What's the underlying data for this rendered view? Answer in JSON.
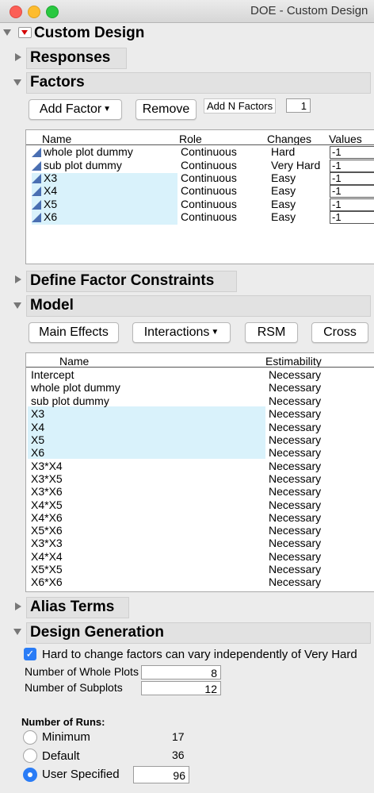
{
  "window": {
    "title": "DOE - Custom Design"
  },
  "outline": {
    "title": "Custom Design",
    "sections": {
      "responses": "Responses",
      "factors": "Factors",
      "constraints": "Define Factor Constraints",
      "model": "Model",
      "alias": "Alias Terms",
      "generation": "Design Generation"
    }
  },
  "factors": {
    "add_factor_label": "Add Factor",
    "remove_label": "Remove",
    "add_n_label": "Add N Factors",
    "add_n_value": "1",
    "columns": [
      "Name",
      "Role",
      "Changes",
      "Values"
    ],
    "rows": [
      {
        "name": "whole plot dummy",
        "role": "Continuous",
        "changes": "Hard",
        "value": "-1",
        "highlight": false
      },
      {
        "name": "sub plot dummy",
        "role": "Continuous",
        "changes": "Very Hard",
        "value": "-1",
        "highlight": false
      },
      {
        "name": "X3",
        "role": "Continuous",
        "changes": "Easy",
        "value": "-1",
        "highlight": true
      },
      {
        "name": "X4",
        "role": "Continuous",
        "changes": "Easy",
        "value": "-1",
        "highlight": true
      },
      {
        "name": "X5",
        "role": "Continuous",
        "changes": "Easy",
        "value": "-1",
        "highlight": true
      },
      {
        "name": "X6",
        "role": "Continuous",
        "changes": "Easy",
        "value": "-1",
        "highlight": true
      }
    ]
  },
  "model": {
    "buttons": {
      "main_effects": "Main Effects",
      "interactions": "Interactions",
      "rsm": "RSM",
      "cross": "Cross"
    },
    "columns": [
      "Name",
      "Estimability"
    ],
    "terms": [
      {
        "name": "Intercept",
        "est": "Necessary",
        "highlight": false
      },
      {
        "name": "whole plot dummy",
        "est": "Necessary",
        "highlight": false
      },
      {
        "name": "sub plot dummy",
        "est": "Necessary",
        "highlight": false
      },
      {
        "name": "X3",
        "est": "Necessary",
        "highlight": true
      },
      {
        "name": "X4",
        "est": "Necessary",
        "highlight": true
      },
      {
        "name": "X5",
        "est": "Necessary",
        "highlight": true
      },
      {
        "name": "X6",
        "est": "Necessary",
        "highlight": true
      },
      {
        "name": "X3*X4",
        "est": "Necessary",
        "highlight": false
      },
      {
        "name": "X3*X5",
        "est": "Necessary",
        "highlight": false
      },
      {
        "name": "X3*X6",
        "est": "Necessary",
        "highlight": false
      },
      {
        "name": "X4*X5",
        "est": "Necessary",
        "highlight": false
      },
      {
        "name": "X4*X6",
        "est": "Necessary",
        "highlight": false
      },
      {
        "name": "X5*X6",
        "est": "Necessary",
        "highlight": false
      },
      {
        "name": "X3*X3",
        "est": "Necessary",
        "highlight": false
      },
      {
        "name": "X4*X4",
        "est": "Necessary",
        "highlight": false
      },
      {
        "name": "X5*X5",
        "est": "Necessary",
        "highlight": false
      },
      {
        "name": "X6*X6",
        "est": "Necessary",
        "highlight": false
      }
    ]
  },
  "generation": {
    "hard_to_change_label": "Hard to change factors can vary independently of Very Hard",
    "hard_to_change_checked": true,
    "whole_plots_label": "Number of Whole Plots",
    "whole_plots_value": "8",
    "subplots_label": "Number of Subplots",
    "subplots_value": "12",
    "runs_label": "Number of Runs:",
    "runs_options": [
      {
        "label": "Minimum",
        "value": "17",
        "selected": false
      },
      {
        "label": "Default",
        "value": "36",
        "selected": false
      },
      {
        "label": "User Specified",
        "value": "96",
        "selected": true
      }
    ]
  },
  "colors": {
    "highlight": "#d9f2fb",
    "accent": "#2a7cf6",
    "factor_icon": "#4a6fb2",
    "red_triangle": "#d40000"
  }
}
